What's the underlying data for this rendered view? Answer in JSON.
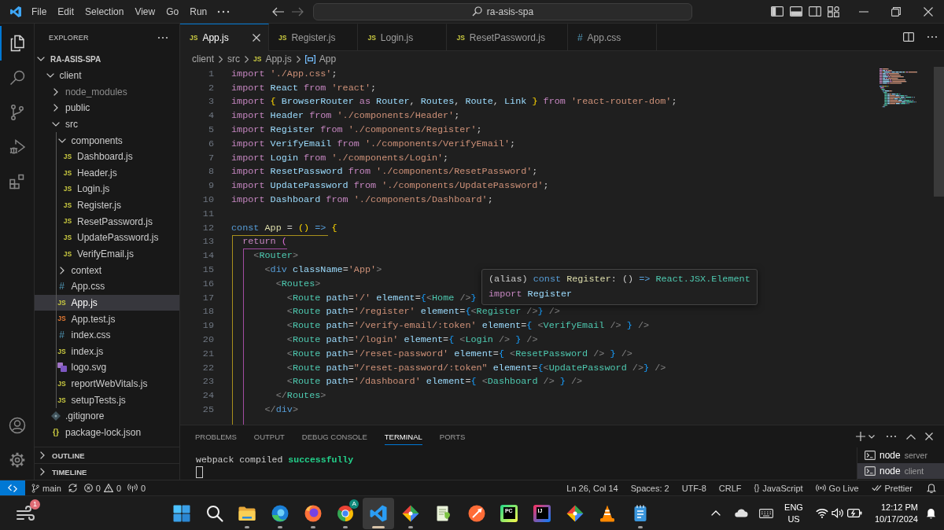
{
  "title_bar": {
    "menu": [
      "File",
      "Edit",
      "Selection",
      "View",
      "Go",
      "Run"
    ],
    "command_center": {
      "text": "ra-asis-spa"
    }
  },
  "activity_bar": {
    "items": [
      {
        "kind": "explorer",
        "selected": true
      },
      {
        "kind": "search",
        "selected": false
      },
      {
        "kind": "source-control",
        "selected": false
      },
      {
        "kind": "run-debug",
        "selected": false
      },
      {
        "kind": "extensions",
        "selected": false
      }
    ],
    "bottom": [
      {
        "kind": "account"
      },
      {
        "kind": "settings"
      }
    ]
  },
  "sidebar": {
    "title": "EXPLORER",
    "tree": [
      {
        "name": "RA-ASIS-SPA",
        "kind": "root",
        "expanded": true,
        "selected": false,
        "children": [
          {
            "name": "client",
            "kind": "folder",
            "expanded": true,
            "selected": false,
            "children": [
              {
                "name": "node_modules",
                "kind": "folder",
                "expanded": false,
                "selected": false,
                "dimmed": true
              },
              {
                "name": "public",
                "kind": "folder",
                "expanded": false,
                "selected": false,
                "dimmed": false
              },
              {
                "name": "src",
                "kind": "folder",
                "expanded": true,
                "selected": false,
                "dimmed": false,
                "children": [
                  {
                    "name": "components",
                    "kind": "folder",
                    "expanded": true,
                    "selected": false,
                    "children": [
                      {
                        "name": "Dashboard.js",
                        "kind": "js",
                        "icon": "JS",
                        "selected": false
                      },
                      {
                        "name": "Header.js",
                        "kind": "js",
                        "icon": "JS",
                        "selected": false
                      },
                      {
                        "name": "Login.js",
                        "kind": "js",
                        "icon": "JS",
                        "selected": false
                      },
                      {
                        "name": "Register.js",
                        "kind": "js",
                        "icon": "JS",
                        "selected": false
                      },
                      {
                        "name": "ResetPassword.js",
                        "kind": "js",
                        "icon": "JS",
                        "selected": false
                      },
                      {
                        "name": "UpdatePassword.js",
                        "kind": "js",
                        "icon": "JS",
                        "selected": false
                      },
                      {
                        "name": "VerifyEmail.js",
                        "kind": "js",
                        "icon": "JS",
                        "selected": false
                      }
                    ]
                  },
                  {
                    "name": "context",
                    "kind": "folder",
                    "expanded": false,
                    "selected": false
                  },
                  {
                    "name": "App.css",
                    "kind": "css",
                    "icon": "#",
                    "selected": false
                  },
                  {
                    "name": "App.js",
                    "kind": "js",
                    "icon": "JS",
                    "selected": true
                  },
                  {
                    "name": "App.test.js",
                    "kind": "test",
                    "icon": "JS",
                    "selected": false
                  },
                  {
                    "name": "index.css",
                    "kind": "css",
                    "icon": "#",
                    "selected": false
                  },
                  {
                    "name": "index.js",
                    "kind": "js",
                    "icon": "JS",
                    "selected": false
                  },
                  {
                    "name": "logo.svg",
                    "kind": "svg",
                    "selected": false
                  },
                  {
                    "name": "reportWebVitals.js",
                    "kind": "js",
                    "icon": "JS",
                    "selected": false
                  },
                  {
                    "name": "setupTests.js",
                    "kind": "js",
                    "icon": "JS",
                    "selected": false
                  }
                ]
              },
              {
                "name": ".gitignore",
                "kind": "git",
                "selected": false,
                "dimmed": false
              },
              {
                "name": "package-lock.json",
                "kind": "json",
                "icon": "{}",
                "selected": false,
                "dimmed": false
              }
            ]
          }
        ]
      }
    ],
    "sections": [
      {
        "title": "OUTLINE",
        "expanded": false
      },
      {
        "title": "TIMELINE",
        "expanded": false
      }
    ]
  },
  "editor": {
    "tabs": [
      {
        "label": "App.js",
        "kind": "js",
        "icon": "JS",
        "selected": true
      },
      {
        "label": "Register.js",
        "kind": "js",
        "icon": "JS",
        "selected": false
      },
      {
        "label": "Login.js",
        "kind": "js",
        "icon": "JS",
        "selected": false
      },
      {
        "label": "ResetPassword.js",
        "kind": "js",
        "icon": "JS",
        "selected": false
      },
      {
        "label": "App.css",
        "kind": "css",
        "icon": "#",
        "selected": false
      }
    ],
    "breadcrumb": [
      {
        "label": "client",
        "kind": "folder"
      },
      {
        "label": "src",
        "kind": "folder"
      },
      {
        "label": "App.js",
        "kind": "js",
        "icon": "JS"
      },
      {
        "label": "App",
        "kind": "symbol"
      }
    ],
    "lines": [
      {
        "number": "1",
        "tokens": [
          {
            "text": "import ",
            "kind": "kw"
          },
          {
            "text": "'./App.css'",
            "kind": "str"
          },
          {
            "text": ";",
            "kind": "p"
          }
        ]
      },
      {
        "number": "2",
        "tokens": [
          {
            "text": "import ",
            "kind": "kw"
          },
          {
            "text": "React ",
            "kind": "var"
          },
          {
            "text": "from ",
            "kind": "kw"
          },
          {
            "text": "'react'",
            "kind": "str"
          },
          {
            "text": ";",
            "kind": "p"
          }
        ]
      },
      {
        "number": "3",
        "tokens": [
          {
            "text": "import ",
            "kind": "kw"
          },
          {
            "text": "{",
            "kind": "b1"
          },
          {
            "text": " BrowserRouter ",
            "kind": "var"
          },
          {
            "text": "as ",
            "kind": "kw"
          },
          {
            "text": "Router",
            "kind": "var"
          },
          {
            "text": ", ",
            "kind": "p"
          },
          {
            "text": "Routes",
            "kind": "var"
          },
          {
            "text": ", ",
            "kind": "p"
          },
          {
            "text": "Route",
            "kind": "var"
          },
          {
            "text": ", ",
            "kind": "p"
          },
          {
            "text": "Link ",
            "kind": "var"
          },
          {
            "text": "}",
            "kind": "b1"
          },
          {
            "text": " from ",
            "kind": "kw"
          },
          {
            "text": "'react-router-dom'",
            "kind": "str"
          },
          {
            "text": ";",
            "kind": "p"
          }
        ]
      },
      {
        "number": "4",
        "tokens": [
          {
            "text": "import ",
            "kind": "kw"
          },
          {
            "text": "Header ",
            "kind": "var"
          },
          {
            "text": "from ",
            "kind": "kw"
          },
          {
            "text": "'./components/Header'",
            "kind": "str"
          },
          {
            "text": ";",
            "kind": "p"
          }
        ]
      },
      {
        "number": "5",
        "tokens": [
          {
            "text": "import ",
            "kind": "kw"
          },
          {
            "text": "Register ",
            "kind": "var"
          },
          {
            "text": "from ",
            "kind": "kw"
          },
          {
            "text": "'./components/Register'",
            "kind": "str"
          },
          {
            "text": ";",
            "kind": "p"
          }
        ]
      },
      {
        "number": "6",
        "tokens": [
          {
            "text": "import ",
            "kind": "kw"
          },
          {
            "text": "VerifyEmail ",
            "kind": "var"
          },
          {
            "text": "from ",
            "kind": "kw"
          },
          {
            "text": "'./components/VerifyEmail'",
            "kind": "str"
          },
          {
            "text": ";",
            "kind": "p"
          }
        ]
      },
      {
        "number": "7",
        "tokens": [
          {
            "text": "import ",
            "kind": "kw"
          },
          {
            "text": "Login ",
            "kind": "var"
          },
          {
            "text": "from ",
            "kind": "kw"
          },
          {
            "text": "'./components/Login'",
            "kind": "str"
          },
          {
            "text": ";",
            "kind": "p"
          }
        ]
      },
      {
        "number": "8",
        "tokens": [
          {
            "text": "import ",
            "kind": "kw"
          },
          {
            "text": "ResetPassword ",
            "kind": "var"
          },
          {
            "text": "from ",
            "kind": "kw"
          },
          {
            "text": "'./components/ResetPassword'",
            "kind": "str"
          },
          {
            "text": ";",
            "kind": "p"
          }
        ]
      },
      {
        "number": "9",
        "tokens": [
          {
            "text": "import ",
            "kind": "kw"
          },
          {
            "text": "UpdatePassword ",
            "kind": "var"
          },
          {
            "text": "from ",
            "kind": "kw"
          },
          {
            "text": "'./components/UpdatePassword'",
            "kind": "str"
          },
          {
            "text": ";",
            "kind": "p"
          }
        ]
      },
      {
        "number": "10",
        "tokens": [
          {
            "text": "import ",
            "kind": "kw"
          },
          {
            "text": "Dashboard ",
            "kind": "var"
          },
          {
            "text": "from ",
            "kind": "kw"
          },
          {
            "text": "'./components/Dashboard'",
            "kind": "str"
          },
          {
            "text": ";",
            "kind": "p"
          }
        ]
      },
      {
        "number": "11"
      },
      {
        "number": "12",
        "tokens": [
          {
            "text": "const ",
            "kind": "decl"
          },
          {
            "text": "App ",
            "kind": "fn"
          },
          {
            "text": "= ",
            "kind": "p"
          },
          {
            "text": "() ",
            "kind": "b1"
          },
          {
            "text": "=> ",
            "kind": "decl"
          },
          {
            "text": "{",
            "kind": "b1"
          }
        ]
      },
      {
        "number": "13",
        "tokens": [
          {
            "text": "  return ",
            "kind": "kw"
          },
          {
            "text": "(",
            "kind": "b2"
          }
        ]
      },
      {
        "number": "14",
        "tokens": [
          {
            "text": "    <",
            "kind": "tag"
          },
          {
            "text": "Router",
            "kind": "type"
          },
          {
            "text": ">",
            "kind": "tag"
          }
        ]
      },
      {
        "number": "15",
        "tokens": [
          {
            "text": "      <",
            "kind": "tag"
          },
          {
            "text": "div",
            "kind": "decl"
          },
          {
            "text": " className",
            "kind": "var"
          },
          {
            "text": "=",
            "kind": "p"
          },
          {
            "text": "'App'",
            "kind": "str"
          },
          {
            "text": ">",
            "kind": "tag"
          }
        ]
      },
      {
        "number": "16",
        "tokens": [
          {
            "text": "        <",
            "kind": "tag"
          },
          {
            "text": "Routes",
            "kind": "type"
          },
          {
            "text": ">",
            "kind": "tag"
          }
        ]
      },
      {
        "number": "17",
        "tokens": [
          {
            "text": "          <",
            "kind": "tag"
          },
          {
            "text": "Route",
            "kind": "type"
          },
          {
            "text": " path",
            "kind": "var"
          },
          {
            "text": "=",
            "kind": "p"
          },
          {
            "text": "'/'",
            "kind": "str"
          },
          {
            "text": " element",
            "kind": "var"
          },
          {
            "text": "=",
            "kind": "p"
          },
          {
            "text": "{",
            "kind": "b3"
          },
          {
            "text": "<",
            "kind": "tag"
          },
          {
            "text": "Home",
            "kind": "type"
          },
          {
            "text": " />",
            "kind": "tag"
          },
          {
            "text": "}",
            "kind": "b3"
          }
        ]
      },
      {
        "number": "18",
        "tokens": [
          {
            "text": "          <",
            "kind": "tag"
          },
          {
            "text": "Route",
            "kind": "type"
          },
          {
            "text": " path",
            "kind": "var"
          },
          {
            "text": "=",
            "kind": "p"
          },
          {
            "text": "'/register'",
            "kind": "str"
          },
          {
            "text": " element",
            "kind": "var"
          },
          {
            "text": "=",
            "kind": "p"
          },
          {
            "text": "{",
            "kind": "b3"
          },
          {
            "text": "<",
            "kind": "tag"
          },
          {
            "text": "Register",
            "kind": "type"
          },
          {
            "text": " />",
            "kind": "tag"
          },
          {
            "text": "}",
            "kind": "b3"
          },
          {
            "text": " />",
            "kind": "tag"
          }
        ]
      },
      {
        "number": "19",
        "tokens": [
          {
            "text": "          <",
            "kind": "tag"
          },
          {
            "text": "Route",
            "kind": "type"
          },
          {
            "text": " path",
            "kind": "var"
          },
          {
            "text": "=",
            "kind": "p"
          },
          {
            "text": "'/verify-email/:token'",
            "kind": "str"
          },
          {
            "text": " element",
            "kind": "var"
          },
          {
            "text": "=",
            "kind": "p"
          },
          {
            "text": "{",
            "kind": "b3"
          },
          {
            "text": " <",
            "kind": "tag"
          },
          {
            "text": "VerifyEmail",
            "kind": "type"
          },
          {
            "text": " />",
            "kind": "tag"
          },
          {
            "text": " }",
            "kind": "b3"
          },
          {
            "text": " />",
            "kind": "tag"
          }
        ]
      },
      {
        "number": "20",
        "tokens": [
          {
            "text": "          <",
            "kind": "tag"
          },
          {
            "text": "Route",
            "kind": "type"
          },
          {
            "text": " path",
            "kind": "var"
          },
          {
            "text": "=",
            "kind": "p"
          },
          {
            "text": "'/login'",
            "kind": "str"
          },
          {
            "text": " element",
            "kind": "var"
          },
          {
            "text": "=",
            "kind": "p"
          },
          {
            "text": "{",
            "kind": "b3"
          },
          {
            "text": " <",
            "kind": "tag"
          },
          {
            "text": "Login",
            "kind": "type"
          },
          {
            "text": " />",
            "kind": "tag"
          },
          {
            "text": " }",
            "kind": "b3"
          },
          {
            "text": " />",
            "kind": "tag"
          }
        ]
      },
      {
        "number": "21",
        "tokens": [
          {
            "text": "          <",
            "kind": "tag"
          },
          {
            "text": "Route",
            "kind": "type"
          },
          {
            "text": " path",
            "kind": "var"
          },
          {
            "text": "=",
            "kind": "p"
          },
          {
            "text": "'/reset-password'",
            "kind": "str"
          },
          {
            "text": " element",
            "kind": "var"
          },
          {
            "text": "=",
            "kind": "p"
          },
          {
            "text": "{",
            "kind": "b3"
          },
          {
            "text": " <",
            "kind": "tag"
          },
          {
            "text": "ResetPassword",
            "kind": "type"
          },
          {
            "text": " />",
            "kind": "tag"
          },
          {
            "text": " }",
            "kind": "b3"
          },
          {
            "text": " />",
            "kind": "tag"
          }
        ]
      },
      {
        "number": "22",
        "tokens": [
          {
            "text": "          <",
            "kind": "tag"
          },
          {
            "text": "Route",
            "kind": "type"
          },
          {
            "text": " path",
            "kind": "var"
          },
          {
            "text": "=",
            "kind": "p"
          },
          {
            "text": "\"/reset-password/:token\"",
            "kind": "str"
          },
          {
            "text": " element",
            "kind": "var"
          },
          {
            "text": "=",
            "kind": "p"
          },
          {
            "text": "{",
            "kind": "b3"
          },
          {
            "text": "<",
            "kind": "tag"
          },
          {
            "text": "UpdatePassword",
            "kind": "type"
          },
          {
            "text": " />",
            "kind": "tag"
          },
          {
            "text": "}",
            "kind": "b3"
          },
          {
            "text": " />",
            "kind": "tag"
          }
        ]
      },
      {
        "number": "23",
        "tokens": [
          {
            "text": "          <",
            "kind": "tag"
          },
          {
            "text": "Route",
            "kind": "type"
          },
          {
            "text": " path",
            "kind": "var"
          },
          {
            "text": "=",
            "kind": "p"
          },
          {
            "text": "'/dashboard'",
            "kind": "str"
          },
          {
            "text": " element",
            "kind": "var"
          },
          {
            "text": "=",
            "kind": "p"
          },
          {
            "text": "{",
            "kind": "b3"
          },
          {
            "text": " <",
            "kind": "tag"
          },
          {
            "text": "Dashboard",
            "kind": "type"
          },
          {
            "text": " />",
            "kind": "tag"
          },
          {
            "text": " }",
            "kind": "b3"
          },
          {
            "text": " />",
            "kind": "tag"
          }
        ]
      },
      {
        "number": "24",
        "tokens": [
          {
            "text": "        </",
            "kind": "tag"
          },
          {
            "text": "Routes",
            "kind": "type"
          },
          {
            "text": ">",
            "kind": "tag"
          }
        ]
      },
      {
        "number": "25",
        "tokens": [
          {
            "text": "      </",
            "kind": "tag"
          },
          {
            "text": "div",
            "kind": "decl"
          },
          {
            "text": ">",
            "kind": "tag"
          }
        ]
      }
    ],
    "hover": {
      "lines": [
        {
          "tokens": [
            {
              "text": "(alias) ",
              "kind": "p"
            },
            {
              "text": "const ",
              "kind": "decl"
            },
            {
              "text": "Register",
              "kind": "fn"
            },
            {
              "text": ": () ",
              "kind": "p"
            },
            {
              "text": "=>",
              "kind": "decl"
            },
            {
              "text": " React.JSX.Element",
              "kind": "type"
            }
          ]
        },
        {
          "tokens": [
            {
              "text": "import ",
              "kind": "kw"
            },
            {
              "text": "Register",
              "kind": "var"
            }
          ]
        }
      ]
    }
  },
  "panel": {
    "tabs": [
      {
        "label": "PROBLEMS",
        "selected": false
      },
      {
        "label": "OUTPUT",
        "selected": false
      },
      {
        "label": "DEBUG CONSOLE",
        "selected": false
      },
      {
        "label": "TERMINAL",
        "selected": true
      },
      {
        "label": "PORTS",
        "selected": false
      }
    ],
    "terminal": {
      "lines": [
        {
          "tokens": [
            {
              "text": "webpack compiled ",
              "kind": "plain"
            },
            {
              "text": "successfully",
              "kind": "success"
            }
          ]
        }
      ]
    },
    "terminals": [
      {
        "name": "node",
        "detail": "server",
        "selected": false
      },
      {
        "name": "node",
        "detail": "client",
        "selected": true
      }
    ]
  },
  "status_bar": {
    "branch": "main",
    "errors": "0",
    "warnings": "0",
    "ports": "0",
    "items": [
      {
        "kind": "text",
        "label": "Ln 26, Col 14"
      },
      {
        "kind": "text",
        "label": "Spaces: 2"
      },
      {
        "kind": "text",
        "label": "UTF-8"
      },
      {
        "kind": "text",
        "label": "CRLF"
      },
      {
        "kind": "language",
        "icon": "{}",
        "label": "JavaScript"
      },
      {
        "kind": "live",
        "label": "Go Live"
      },
      {
        "kind": "prettier",
        "label": "Prettier"
      },
      {
        "kind": "bell"
      }
    ]
  },
  "taskbar": {
    "widget": {
      "badge": "1"
    },
    "apps": [
      {
        "kind": "start",
        "running": false,
        "selected": false
      },
      {
        "kind": "search",
        "running": false,
        "selected": false
      },
      {
        "kind": "folder",
        "running": true,
        "selected": false
      },
      {
        "kind": "swirl",
        "running": true,
        "selected": false
      },
      {
        "kind": "fox",
        "running": true,
        "selected": false
      },
      {
        "kind": "wheel",
        "badge": "A",
        "running": true,
        "selected": false
      },
      {
        "kind": "ribbon",
        "running": true,
        "selected": true
      },
      {
        "kind": "diamond",
        "running": true,
        "selected": false
      },
      {
        "kind": "notepad",
        "running": false,
        "selected": false
      },
      {
        "kind": "quill",
        "running": false,
        "selected": false
      },
      {
        "kind": "tile",
        "glyph": "PC",
        "running": false,
        "selected": false
      },
      {
        "kind": "tile2",
        "glyph": "IJ",
        "running": false,
        "selected": false
      },
      {
        "kind": "diamond",
        "running": false,
        "selected": false
      },
      {
        "kind": "cone",
        "running": false,
        "selected": false
      },
      {
        "kind": "notes",
        "running": true,
        "selected": false
      }
    ],
    "tray": {
      "language": "ENG",
      "region": "US",
      "time": "12:12 PM",
      "date": "10/17/2024"
    }
  }
}
